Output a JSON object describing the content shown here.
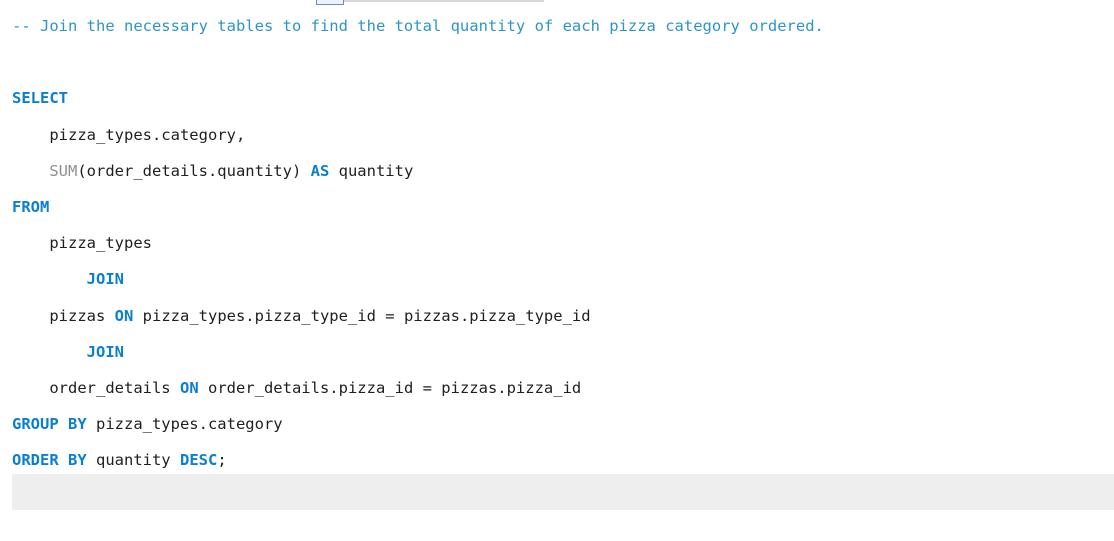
{
  "editor": {
    "lines": [
      {
        "parts": [
          {
            "t": "-- Join the necessary tables to find the total quantity of each pizza category ordered.",
            "k": "comment"
          }
        ]
      },
      {
        "parts": [
          {
            "t": "",
            "k": "ident"
          }
        ]
      },
      {
        "parts": [
          {
            "t": "SELECT",
            "k": "kw"
          }
        ]
      },
      {
        "parts": [
          {
            "t": "    pizza_types.category,",
            "k": "ident"
          }
        ]
      },
      {
        "parts": [
          {
            "t": "    ",
            "k": "ident"
          },
          {
            "t": "SUM",
            "k": "fn"
          },
          {
            "t": "(order_details.quantity) ",
            "k": "ident"
          },
          {
            "t": "AS",
            "k": "kw"
          },
          {
            "t": " quantity",
            "k": "ident"
          }
        ]
      },
      {
        "parts": [
          {
            "t": "FROM",
            "k": "kw"
          }
        ]
      },
      {
        "parts": [
          {
            "t": "    pizza_types",
            "k": "ident"
          }
        ]
      },
      {
        "parts": [
          {
            "t": "        ",
            "k": "ident"
          },
          {
            "t": "JOIN",
            "k": "kw"
          }
        ]
      },
      {
        "parts": [
          {
            "t": "    pizzas ",
            "k": "ident"
          },
          {
            "t": "ON",
            "k": "kw"
          },
          {
            "t": " pizza_types.pizza_type_id = pizzas.pizza_type_id",
            "k": "ident"
          }
        ]
      },
      {
        "parts": [
          {
            "t": "        ",
            "k": "ident"
          },
          {
            "t": "JOIN",
            "k": "kw"
          }
        ]
      },
      {
        "parts": [
          {
            "t": "    order_details ",
            "k": "ident"
          },
          {
            "t": "ON",
            "k": "kw"
          },
          {
            "t": " order_details.pizza_id = pizzas.pizza_id",
            "k": "ident"
          }
        ]
      },
      {
        "parts": [
          {
            "t": "GROUP BY",
            "k": "kw"
          },
          {
            "t": " pizza_types.category",
            "k": "ident"
          }
        ]
      },
      {
        "parts": [
          {
            "t": "ORDER BY",
            "k": "kw"
          },
          {
            "t": " quantity ",
            "k": "ident"
          },
          {
            "t": "DESC",
            "k": "kw"
          },
          {
            "t": ";",
            "k": "ident"
          }
        ]
      }
    ]
  },
  "colors": {
    "comment": "#2d95c9",
    "keyword": "#0a7fd1",
    "function": "#8f8f8f",
    "text": "#1f1f1f",
    "current_line": "#eeeeee"
  }
}
